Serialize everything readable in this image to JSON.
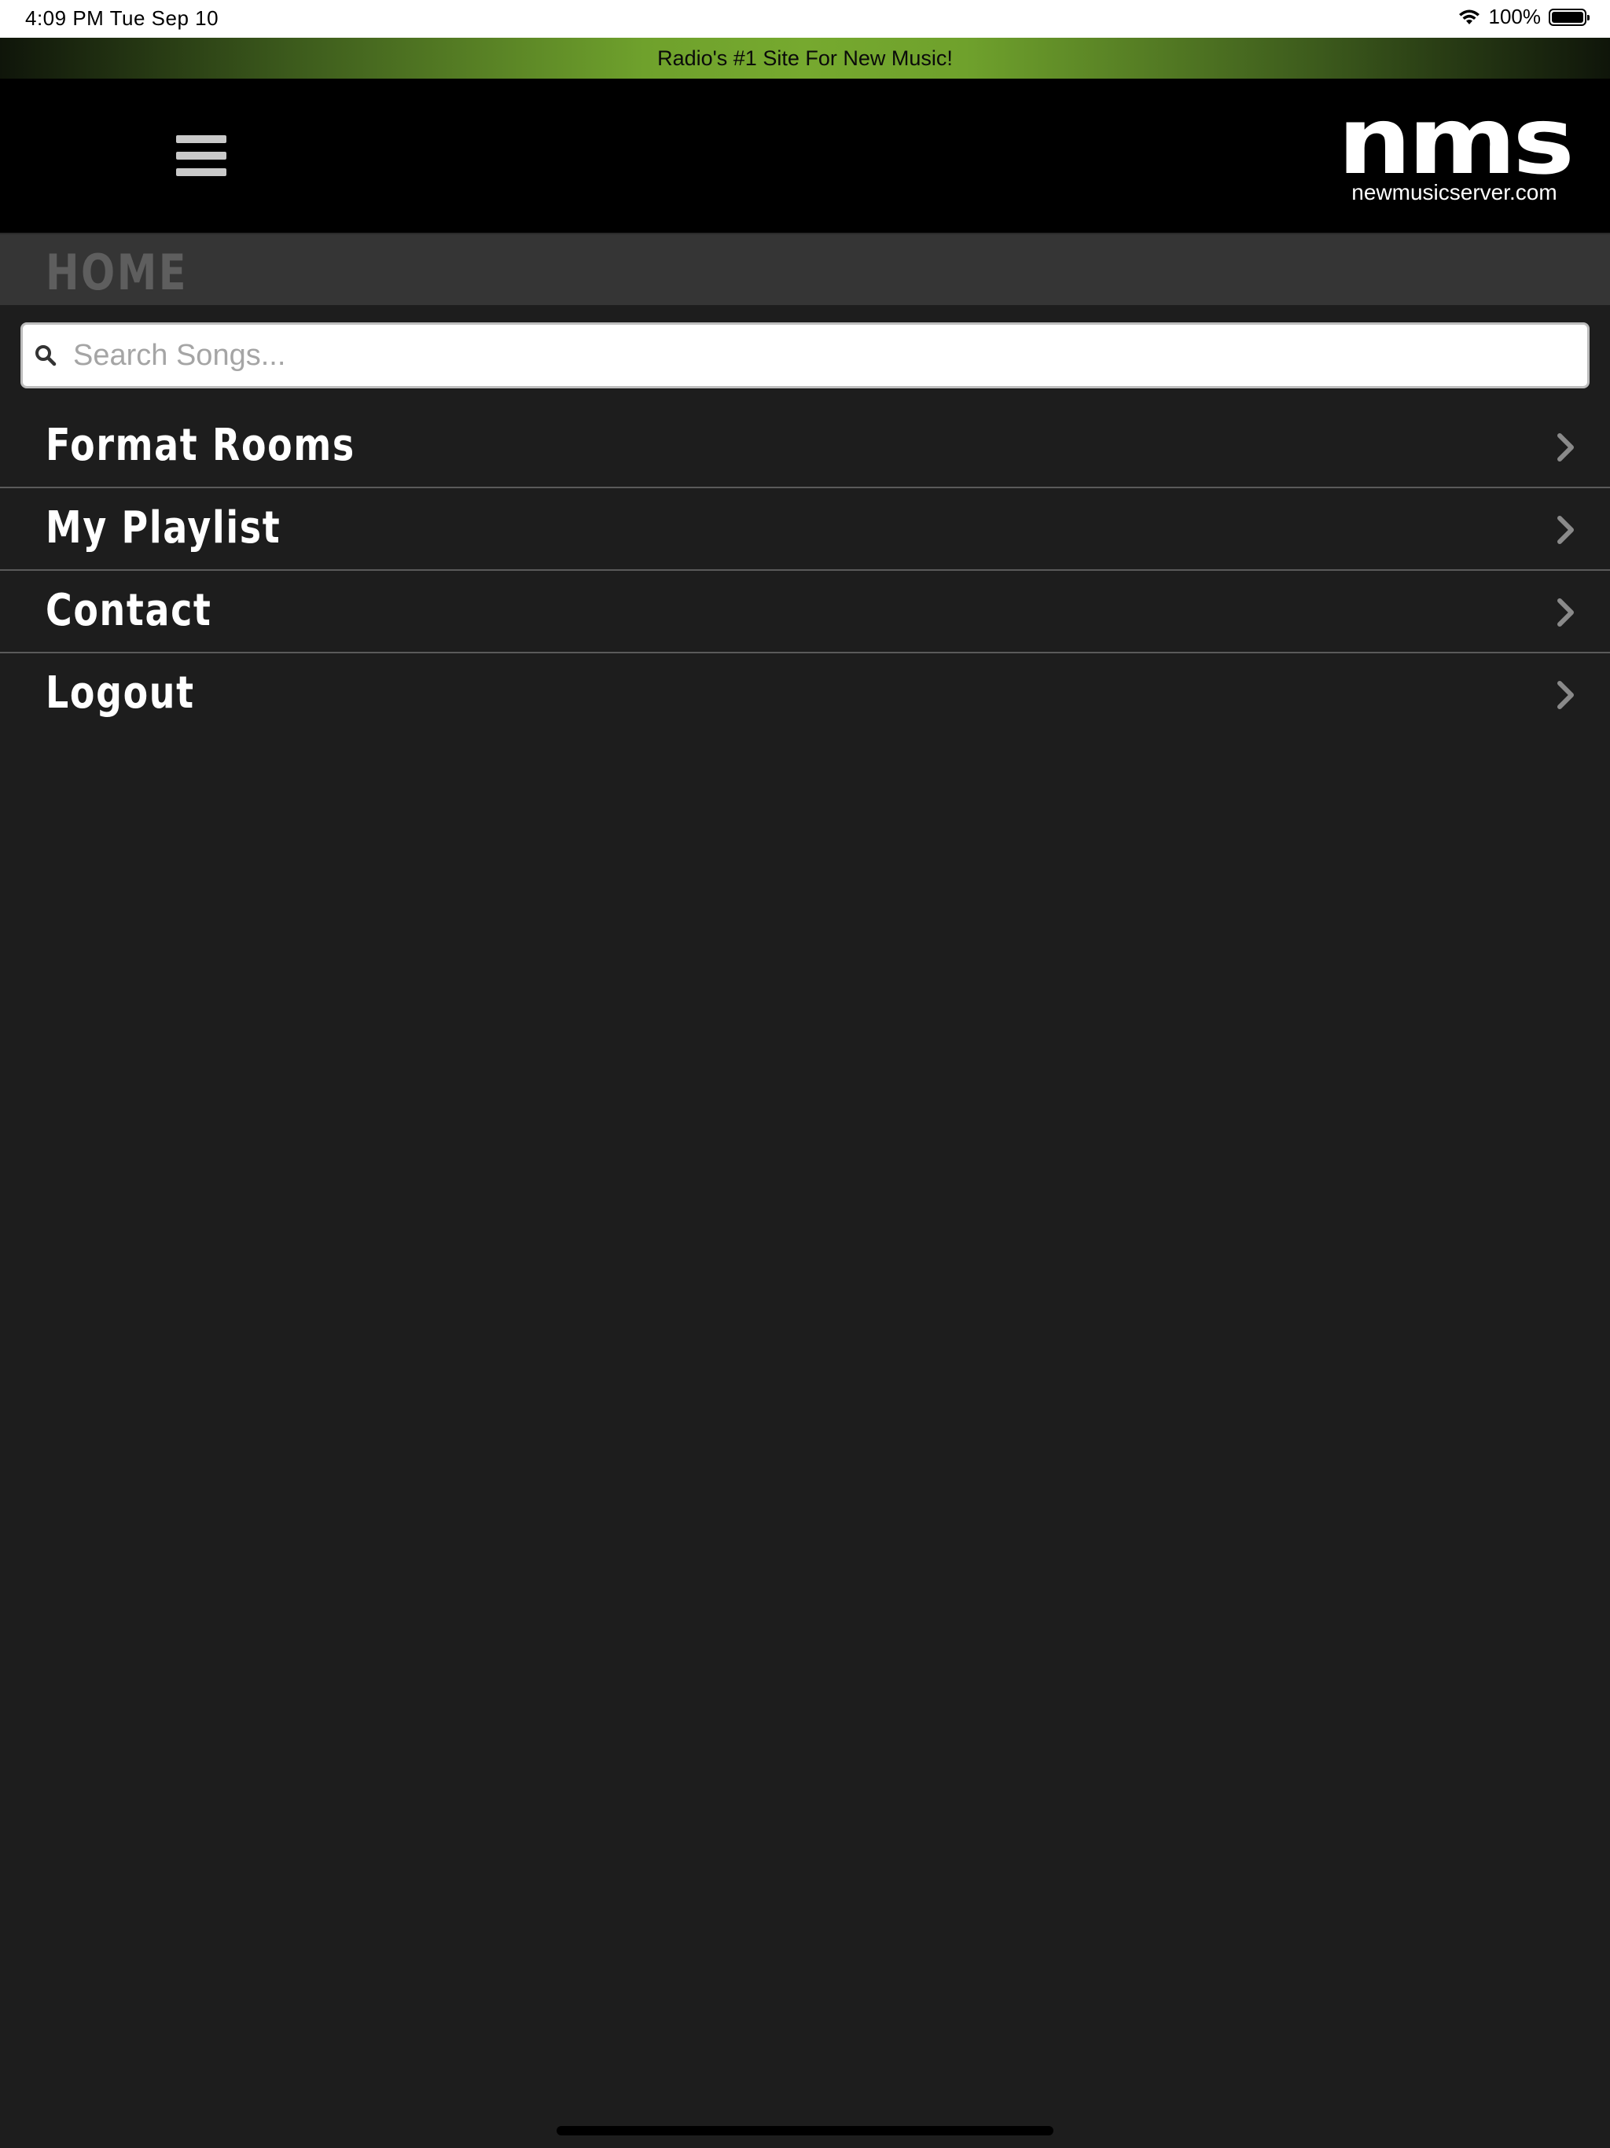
{
  "status_bar": {
    "time": "4:09 PM   Tue Sep 10",
    "battery": "100%"
  },
  "tagline": "Radio's #1 Site For New Music!",
  "header": {
    "logo_mark": "nms",
    "logo_url": "newmusicserver.com"
  },
  "page": {
    "title": "HOME"
  },
  "search": {
    "placeholder": "Search Songs...",
    "value": ""
  },
  "menu": {
    "items": [
      {
        "label": "Format Rooms"
      },
      {
        "label": "My Playlist"
      },
      {
        "label": "Contact"
      },
      {
        "label": "Logout"
      }
    ]
  },
  "colors": {
    "background": "#1d1d1d",
    "header": "#000000",
    "title_bar": "#353535",
    "accent_green": "#76a92f"
  }
}
